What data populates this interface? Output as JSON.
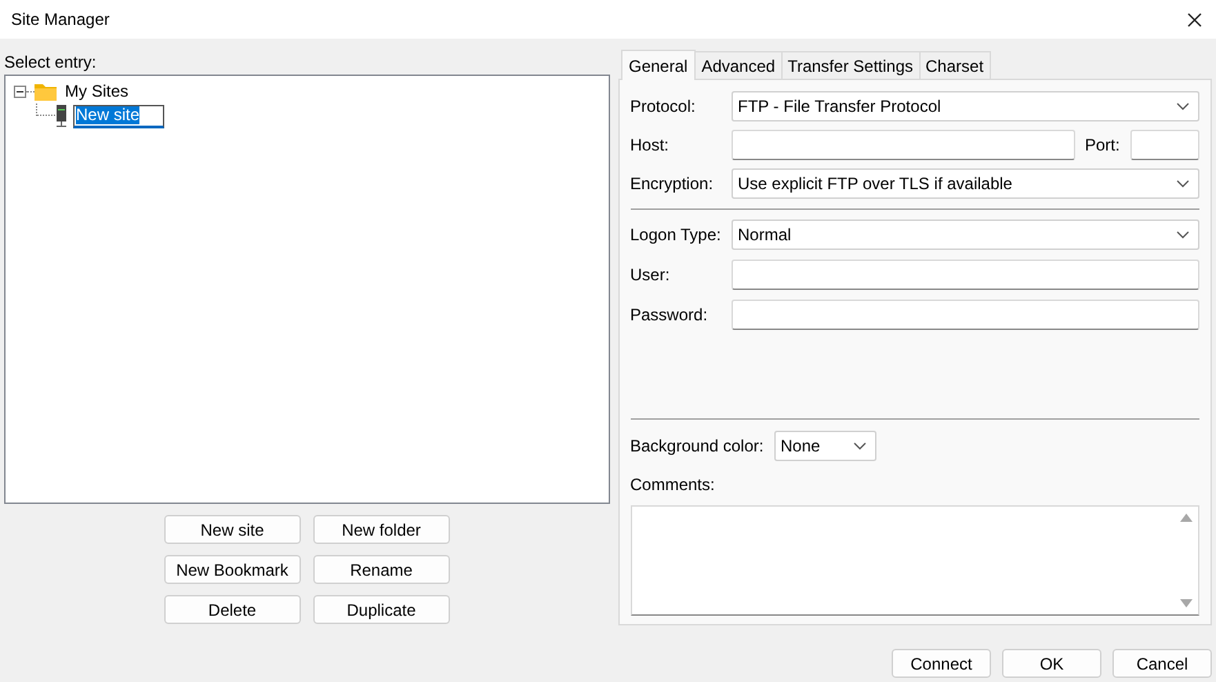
{
  "window": {
    "title": "Site Manager"
  },
  "select_entry_label": "Select entry:",
  "tree": [
    {
      "label": "My Sites",
      "kind": "folder",
      "expanded": true,
      "children": [
        {
          "label": "New site",
          "kind": "site",
          "editing": true
        }
      ]
    }
  ],
  "tree_buttons": [
    [
      "New site",
      "New folder"
    ],
    [
      "New Bookmark",
      "Rename"
    ],
    [
      "Delete",
      "Duplicate"
    ]
  ],
  "tabs": [
    {
      "label": "General",
      "selected": true
    },
    {
      "label": "Advanced",
      "selected": false
    },
    {
      "label": "Transfer Settings",
      "selected": false
    },
    {
      "label": "Charset",
      "selected": false
    }
  ],
  "general": {
    "protocol": {
      "label": "Protocol:",
      "value": "FTP - File Transfer Protocol"
    },
    "host": {
      "label": "Host:"
    },
    "port": {
      "label": "Port:"
    },
    "encryption": {
      "label": "Encryption:",
      "value": "Use explicit FTP over TLS if available"
    },
    "logon_type": {
      "label": "Logon Type:",
      "value": "Normal"
    },
    "user": {
      "label": "User:"
    },
    "password": {
      "label": "Password:"
    },
    "background_color": {
      "label": "Background color:",
      "value": "None"
    },
    "comments": {
      "label": "Comments:"
    }
  },
  "buttons": [
    "Connect",
    "OK",
    "Cancel"
  ]
}
